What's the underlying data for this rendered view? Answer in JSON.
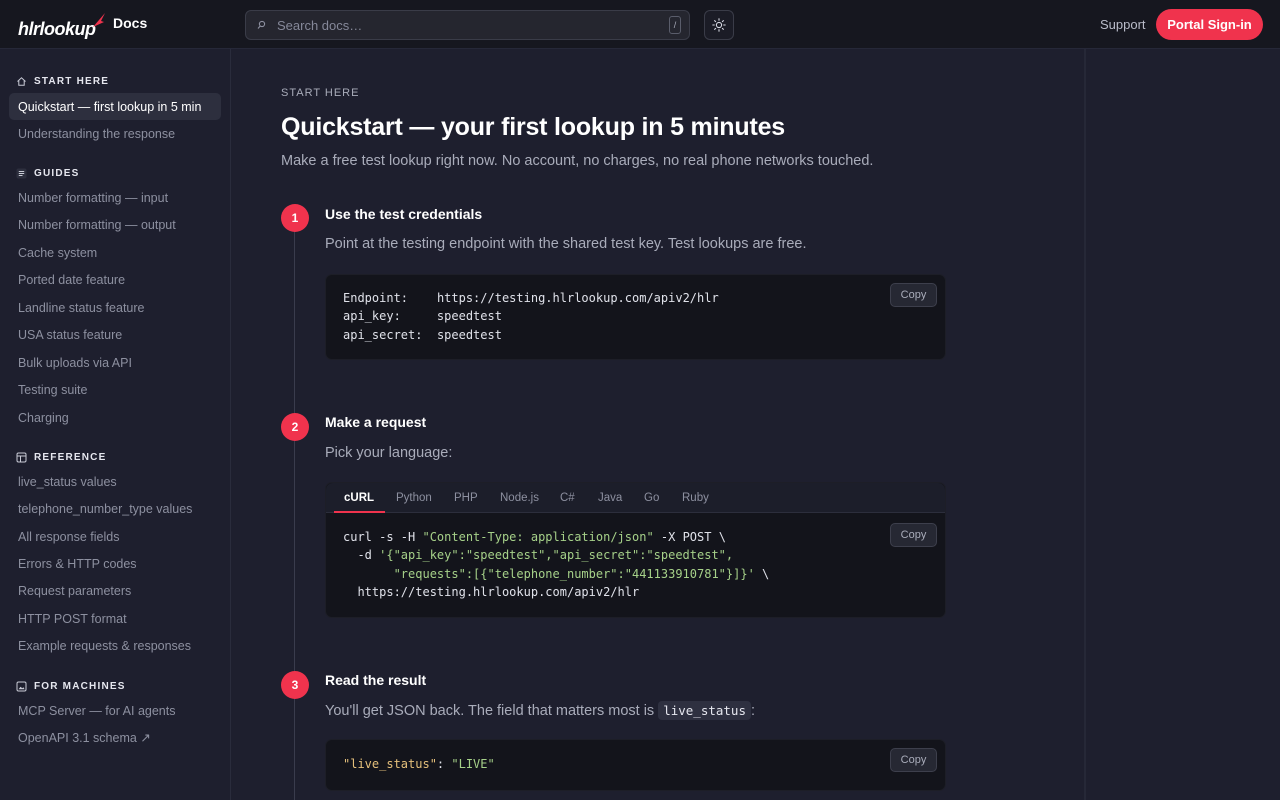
{
  "header": {
    "logo_text": "hlrlookup",
    "docs_label": "Docs",
    "search_placeholder": "Search docs…",
    "search_shortcut": "/",
    "support_label": "Support",
    "signin_label": "Portal Sign-in"
  },
  "sidebar": {
    "sections": [
      {
        "title": "START HERE",
        "icon": "home-icon",
        "items": [
          "Quickstart — first lookup in 5 min",
          "Understanding the response"
        ]
      },
      {
        "title": "GUIDES",
        "icon": "list-icon",
        "items": [
          "Number formatting — input",
          "Number formatting — output",
          "Cache system",
          "Ported date feature",
          "Landline status feature",
          "USA status feature",
          "Bulk uploads via API",
          "Testing suite",
          "Charging"
        ]
      },
      {
        "title": "REFERENCE",
        "icon": "table-icon",
        "items": [
          "live_status values",
          "telephone_number_type values",
          "All response fields",
          "Errors & HTTP codes",
          "Request parameters",
          "HTTP POST format",
          "Example requests & responses"
        ]
      },
      {
        "title": "FOR MACHINES",
        "icon": "image-icon",
        "items": [
          "MCP Server — for AI agents",
          "OpenAPI 3.1 schema ↗"
        ]
      }
    ],
    "active_item": "Quickstart — first lookup in 5 min"
  },
  "page": {
    "eyebrow": "START HERE",
    "title": "Quickstart — your first lookup in 5 minutes",
    "lead": "Make a free test lookup right now. No account, no charges, no real phone networks touched."
  },
  "steps": [
    {
      "number": "1",
      "title": "Use the test credentials",
      "text": "Point at the testing endpoint with the shared test key. Test lookups are free.",
      "code": {
        "lines": [
          {
            "key": "Endpoint:",
            "value": "https://testing.hlrlookup.com/apiv2/hlr"
          },
          {
            "key": "api_key:",
            "value": "speedtest"
          },
          {
            "key": "api_secret:",
            "value": "speedtest"
          }
        ]
      }
    },
    {
      "number": "2",
      "title": "Make a request",
      "text": "Pick your language:",
      "tabs": [
        "cURL",
        "Python",
        "PHP",
        "Node.js",
        "C#",
        "Java",
        "Go",
        "Ruby"
      ],
      "active_tab": "cURL",
      "code": {
        "l1_cmd": "curl -s -H ",
        "l1_str": "\"Content-Type: application/json\"",
        "l1_rest": " -X POST \\",
        "l2_pre": "  -d ",
        "l2_str": "'{\"api_key\":\"speedtest\",\"api_secret\":\"speedtest\",",
        "l3_str": "       \"requests\":[{\"telephone_number\":\"441133910781\"}]}'",
        "l3_rest": " \\",
        "l4": "  https://testing.hlrlookup.com/apiv2/hlr"
      }
    },
    {
      "number": "3",
      "title": "Read the result",
      "text_before": "You'll get JSON back. The field that matters most is ",
      "inline_code": "live_status",
      "text_after": ":",
      "code": {
        "key": "\"live_status\"",
        "sep": ": ",
        "value": "\"LIVE\""
      }
    }
  ],
  "copy_label": "Copy",
  "colors": {
    "accent": "#f0334d",
    "background": "#1e1f2e",
    "code_bg": "#13141b",
    "string": "#a6d189",
    "json_key": "#e5c07b"
  }
}
